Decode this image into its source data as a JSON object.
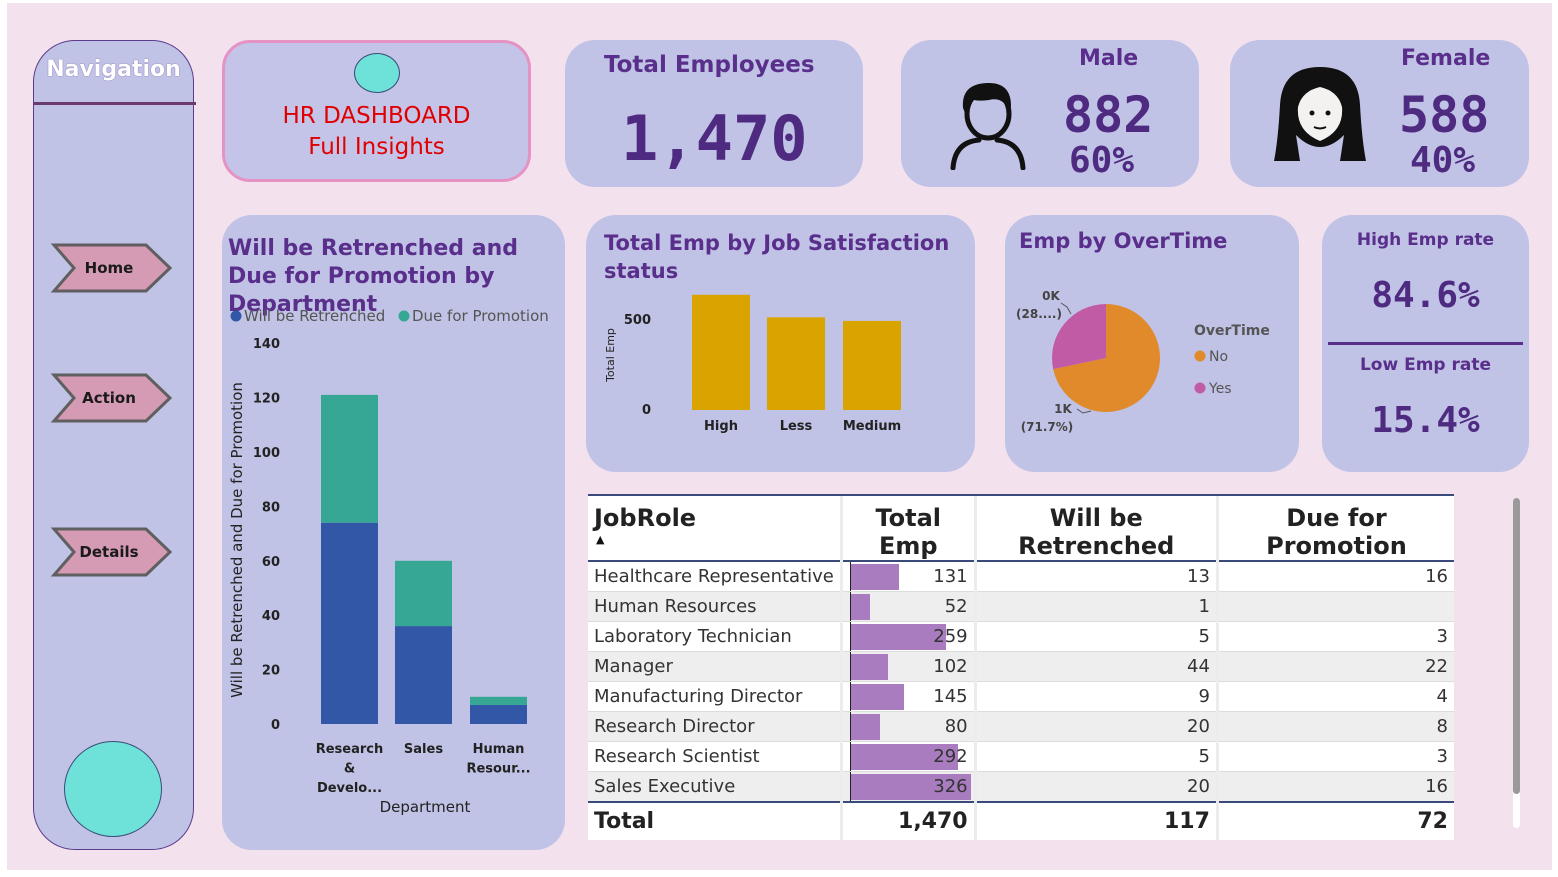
{
  "colors": {
    "background": "#f4e1ee",
    "card": "#c0c3e5",
    "accent_text": "#5a2f8c",
    "retrenched": "#3157a6",
    "promotion": "#36a794",
    "satisfaction_bar": "#d9a400",
    "overtime_no": "#e08a2c",
    "overtime_yes": "#c25ba6",
    "table_bar": "#a97cbf"
  },
  "navigation": {
    "title": "Navigation",
    "buttons": [
      "Home",
      "Action",
      "Details"
    ]
  },
  "title_card": {
    "line1": "HR DASHBOARD",
    "line2": "Full Insights"
  },
  "kpis": {
    "total_employees": {
      "label": "Total Employees",
      "value": "1,470"
    },
    "male": {
      "label": "Male",
      "value": "882",
      "pct": "60%",
      "icon": "male-person-icon"
    },
    "female": {
      "label": "Female",
      "value": "588",
      "pct": "40%",
      "icon": "female-person-icon"
    },
    "rates": {
      "high_label": "High Emp rate",
      "high_value": "84.6%",
      "low_label": "Low Emp rate",
      "low_value": "15.4%"
    }
  },
  "chart_data": [
    {
      "type": "bar",
      "stacked": true,
      "title": "Will be Retrenched and Due for Promotion by Department",
      "xlabel": "Department",
      "ylabel": "Will be Retrenched and Due for Promotion",
      "ylim": [
        0,
        140
      ],
      "yticks": [
        "0",
        "20",
        "40",
        "60",
        "80",
        "100",
        "120",
        "140"
      ],
      "categories": [
        [
          "Research",
          "&",
          "Develo..."
        ],
        [
          "Sales"
        ],
        [
          "Human",
          "Resour..."
        ]
      ],
      "legend": [
        "Will be Retrenched",
        "Due for Promotion"
      ],
      "series": [
        {
          "name": "Will be Retrenched",
          "values": [
            74,
            36,
            7
          ]
        },
        {
          "name": "Due for Promotion",
          "values": [
            47,
            24,
            3
          ]
        }
      ]
    },
    {
      "type": "bar",
      "title": "Total Emp by Job Satisfaction status",
      "ylabel": "Total Emp",
      "yticks": [
        "0",
        "500"
      ],
      "ylim": [
        0,
        700
      ],
      "categories": [
        "High",
        "Less",
        "Medium"
      ],
      "values": [
        640,
        515,
        495
      ]
    },
    {
      "type": "pie",
      "title": "Emp by OverTime",
      "legend_title": "OverTime",
      "slices": [
        {
          "name": "No",
          "value": 1054,
          "label": "1K",
          "pct_label": "(71.7%)"
        },
        {
          "name": "Yes",
          "value": 416,
          "label": "0K",
          "pct_label": "(28....)"
        }
      ]
    }
  ],
  "table": {
    "headers": [
      "JobRole",
      "Total Emp",
      "Will be Retrenched",
      "Due for Promotion"
    ],
    "sort_icon": "sort-ascending-icon",
    "bar_max": 326,
    "rows": [
      {
        "role": "Healthcare Representative",
        "total": 131,
        "total_label": "131",
        "retrenched": "13",
        "promotion": "16"
      },
      {
        "role": "Human Resources",
        "total": 52,
        "total_label": "52",
        "retrenched": "1",
        "promotion": ""
      },
      {
        "role": "Laboratory Technician",
        "total": 259,
        "total_label": "259",
        "retrenched": "5",
        "promotion": "3"
      },
      {
        "role": "Manager",
        "total": 102,
        "total_label": "102",
        "retrenched": "44",
        "promotion": "22"
      },
      {
        "role": "Manufacturing Director",
        "total": 145,
        "total_label": "145",
        "retrenched": "9",
        "promotion": "4"
      },
      {
        "role": "Research Director",
        "total": 80,
        "total_label": "80",
        "retrenched": "20",
        "promotion": "8"
      },
      {
        "role": "Research Scientist",
        "total": 292,
        "total_label": "292",
        "retrenched": "5",
        "promotion": "3"
      },
      {
        "role": "Sales Executive",
        "total": 326,
        "total_label": "326",
        "retrenched": "20",
        "promotion": "16"
      }
    ],
    "total_row": {
      "label": "Total",
      "total": "1,470",
      "retrenched": "117",
      "promotion": "72"
    }
  }
}
